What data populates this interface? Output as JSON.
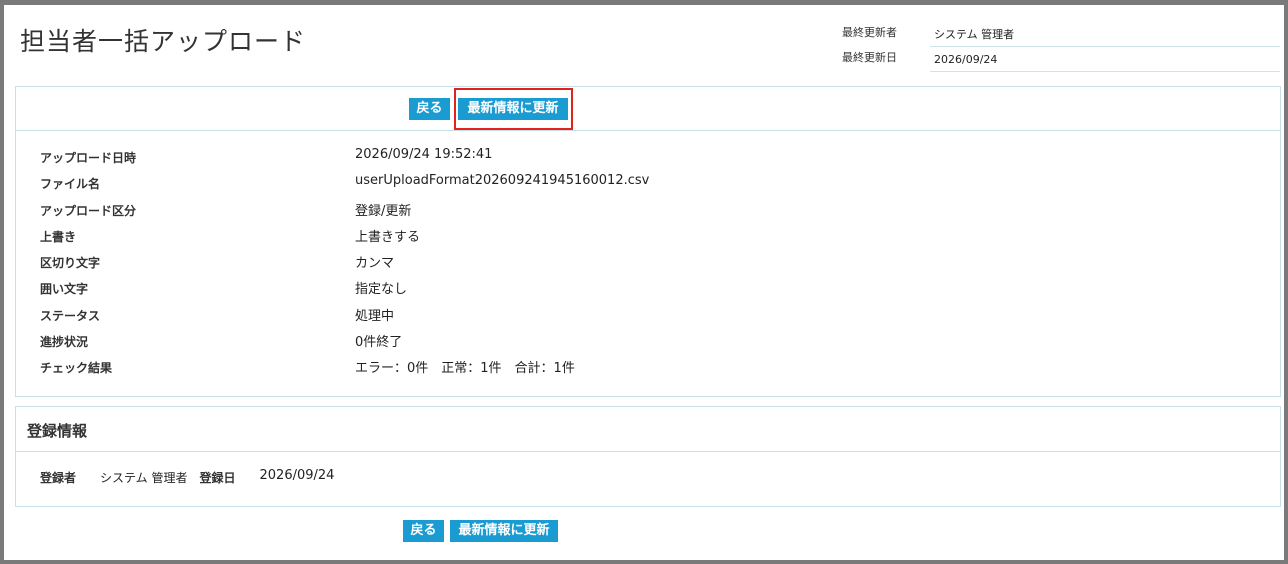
{
  "header": {
    "title": "担当者一括アップロード",
    "last_updated_by_label": "最終更新者",
    "last_updated_by_value": "システム 管理者",
    "last_updated_date_label": "最終更新日",
    "last_updated_date_value": "2026/09/24"
  },
  "toolbar": {
    "back_label": "戻る",
    "refresh_label": "最新情報に更新"
  },
  "details": [
    {
      "label": "アップロード日時",
      "value": "2026/09/24 19:52:41"
    },
    {
      "label": "ファイル名",
      "value": "userUploadFormat202609241945160012.csv"
    },
    {
      "label": "アップロード区分",
      "value": "登録/更新"
    },
    {
      "label": "上書き",
      "value": "上書きする"
    },
    {
      "label": "区切り文字",
      "value": "カンマ"
    },
    {
      "label": "囲い文字",
      "value": "指定なし"
    },
    {
      "label": "ステータス",
      "value": "処理中"
    },
    {
      "label": "進捗状況",
      "value": "0件終了"
    },
    {
      "label": "チェック結果",
      "value": "エラー：0件　正常：1件　合計：1件"
    }
  ],
  "registration": {
    "title": "登録情報",
    "registrant_label": "登録者",
    "registrant_value": "システム 管理者",
    "date_label": "登録日",
    "date_value": "2026/09/24"
  },
  "colors": {
    "button": "#1a9bd1",
    "highlight": "#e2231a",
    "border": "#c9dfe8"
  }
}
